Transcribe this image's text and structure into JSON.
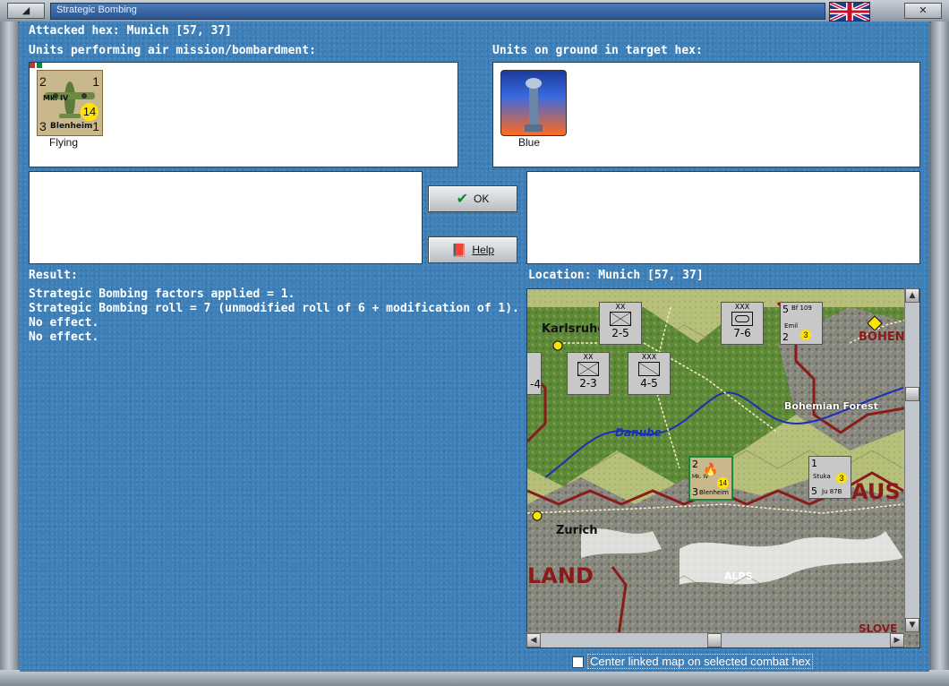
{
  "window": {
    "title": "Strategic Bombing",
    "minimize_glyph": "◢",
    "close_glyph": "✕",
    "restore_glyph": "▭"
  },
  "header": {
    "attacked_hex": "Attacked hex: Munich  [57, 37]"
  },
  "air_units": {
    "label": "Units performing air mission/bombardment:",
    "items": [
      {
        "name": "Blenheim",
        "model": "Mk. IV",
        "top_left": "2",
        "top_right": "1",
        "bottom_left": "3",
        "bottom_right": "1",
        "badge": "14",
        "caption": "Flying"
      }
    ]
  },
  "ground_units": {
    "label": "Units on ground in target hex:",
    "items": [
      {
        "caption": "Blue"
      }
    ]
  },
  "buttons": {
    "ok": "OK",
    "help": "Help"
  },
  "result": {
    "label": "Result:",
    "lines": [
      "Strategic Bombing factors applied = 1.",
      "Strategic Bombing roll = 7 (unmodified roll of 6 + modification of 1).",
      "No effect.",
      "No effect."
    ]
  },
  "location": {
    "label": "Location:  Munich  [57, 37]"
  },
  "map": {
    "place_labels": [
      "Karlsruhe",
      "Bohemian Forest",
      "Danube",
      "Zurich",
      "ALPS",
      "LAND",
      "AUS",
      "BOHEN",
      "SLOVE"
    ],
    "counters": [
      {
        "top": "XX",
        "value": "2-5"
      },
      {
        "top": "XXX",
        "value": "7-6"
      },
      {
        "top": "XX",
        "value": "2-3"
      },
      {
        "top": "XXX",
        "value": "4-5"
      },
      {
        "top": "",
        "value": "-4"
      }
    ],
    "air_counters": [
      {
        "name": "Emil",
        "model": "Bf 109",
        "tl": "5",
        "bl": "2",
        "badge": "3"
      },
      {
        "name": "Ju 87B",
        "model": "Stuka",
        "tl": "1",
        "bl": "5",
        "badge": "3"
      },
      {
        "name": "Blenheim",
        "model": "Mk. IV",
        "tl": "2",
        "bl": "3",
        "badge": "14"
      }
    ]
  },
  "center_map_checkbox": {
    "label": "Center linked map on selected combat hex",
    "checked": false
  },
  "colors": {
    "background_blue": "#3d7fb8",
    "title_blue": "#2b5590",
    "border_red": "#8b1a1a"
  }
}
